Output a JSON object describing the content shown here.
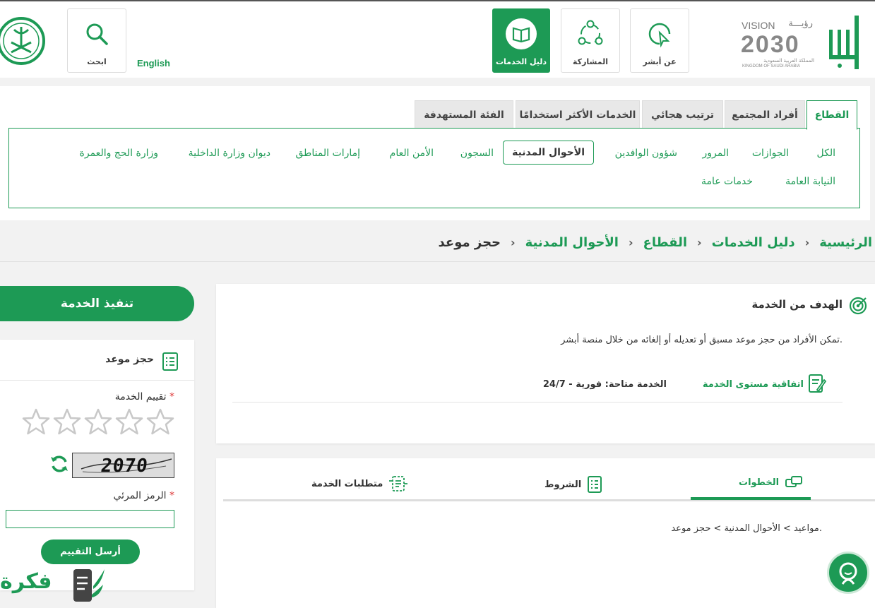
{
  "header": {
    "search_label": "ابحث",
    "language_link": "English",
    "nav": [
      {
        "label": "دليل الخدمات",
        "active": true
      },
      {
        "label": "المشاركة",
        "active": false
      },
      {
        "label": "عن أبشر",
        "active": false
      }
    ],
    "vision": {
      "word": "VISION",
      "arabic": "رؤيـــة",
      "year": "2030",
      "kingdom_ar": "المملكة العربية السعودية",
      "kingdom_en": "KINGDOM OF SAUDI ARABIA"
    },
    "absher_logo_text": "أبشر"
  },
  "tabs": [
    {
      "label": "القطاع",
      "active": true
    },
    {
      "label": "أفراد المجتمع",
      "active": false
    },
    {
      "label": "ترتيب هجائي",
      "active": false
    },
    {
      "label": "الخدمات الأكثر استخدامًا",
      "active": false
    },
    {
      "label": "الفئة المستهدفة",
      "active": false
    }
  ],
  "sectors": [
    {
      "label": "الكل",
      "active": false
    },
    {
      "label": "الجوازات",
      "active": false
    },
    {
      "label": "المرور",
      "active": false
    },
    {
      "label": "شؤون الوافدين",
      "active": false
    },
    {
      "label": "الأحوال المدنية",
      "active": true
    },
    {
      "label": "السجون",
      "active": false
    },
    {
      "label": "الأمن العام",
      "active": false
    },
    {
      "label": "إمارات المناطق",
      "active": false
    },
    {
      "label": "ديوان وزارة الداخلية",
      "active": false
    },
    {
      "label": "وزارة الحج والعمرة",
      "active": false
    },
    {
      "label": "النيابة العامة",
      "active": false
    },
    {
      "label": "خدمات عامة",
      "active": false
    }
  ],
  "breadcrumb": [
    "الرئيسية",
    "دليل الخدمات",
    "القطاع",
    "الأحوال المدنية",
    "حجز موعد"
  ],
  "breadcrumb_sep": "›",
  "goal": {
    "title": "الهدف من الخدمة",
    "text": "تمكن الأفراد من حجز موعد مسبق أو تعديله أو إلغائه من خلال منصة أبشر.",
    "sla_label": "اتفاقية مستوى الخدمة",
    "availability": "الخدمة متاحة: فورية - 24/7"
  },
  "step_tabs": [
    {
      "label": "الخطوات",
      "active": true
    },
    {
      "label": "الشروط",
      "active": false
    },
    {
      "label": "متطلبات الخدمة",
      "active": false
    }
  ],
  "steps_text": "مواعيد > الأحوال المدنية > حجز موعد.",
  "execute_button": "تنفيذ الخدمة",
  "booking": {
    "title": "حجز موعد",
    "rating_label": "تقييم الخدمة",
    "required_mark": "*",
    "stars": 5,
    "rating_value": 0,
    "captcha_code": "2070",
    "code_label": "الرمز المرئي",
    "code_value": "",
    "send_button": "أرسل التقييم"
  },
  "watermark_text": "فكرة",
  "colors": {
    "accent": "#1d9a55",
    "required": "#d33333"
  }
}
